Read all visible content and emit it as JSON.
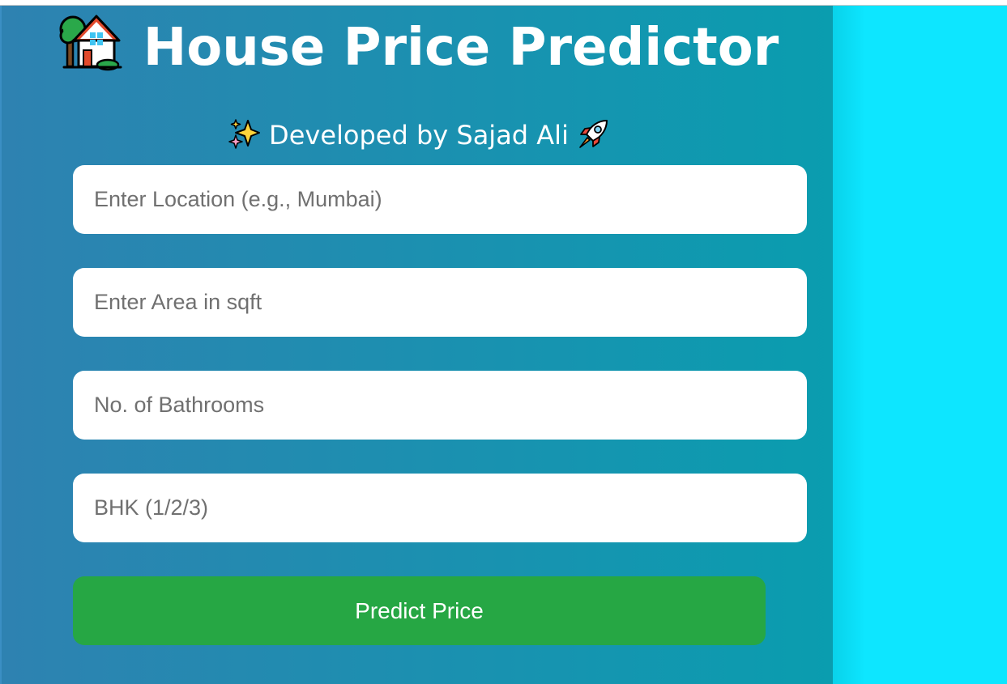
{
  "header": {
    "title": "House Price Predictor",
    "title_icon": "house-with-garden-icon",
    "subtitle": "Developed by Sajad Ali",
    "subtitle_leading_icon": "sparkles-icon",
    "subtitle_trailing_icon": "rocket-icon"
  },
  "form": {
    "location": {
      "placeholder": "Enter Location (e.g., Mumbai)",
      "value": ""
    },
    "area": {
      "placeholder": "Enter Area in sqft",
      "value": ""
    },
    "bathrooms": {
      "placeholder": "No. of Bathrooms",
      "value": ""
    },
    "bhk": {
      "placeholder": "BHK (1/2/3)",
      "value": ""
    },
    "submit_label": "Predict Price"
  },
  "colors": {
    "panel_gradient_start": "#2e82b1",
    "panel_gradient_end": "#0a9daf",
    "page_background": "#0de6ff",
    "button": "#26a744",
    "text_light": "#ffffff"
  }
}
